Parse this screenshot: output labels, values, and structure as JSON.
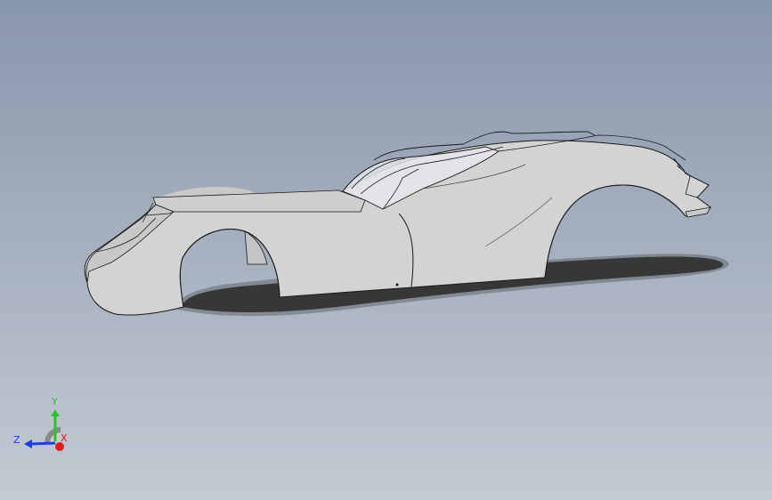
{
  "viewport": {
    "background_top": "#8997ab",
    "background_bottom": "#c3cad3",
    "model": {
      "body_color": "#d4d4d4",
      "edge_color": "#1a1a1a",
      "glass_color": "#e6e8ec",
      "shadow_color": "#2d2d2d"
    }
  },
  "triad": {
    "y_label": "Y",
    "z_label": "Z",
    "x_label": "X",
    "y_color": "#29c22b",
    "z_color": "#1d3ee0",
    "x_color": "#e01b1b"
  }
}
